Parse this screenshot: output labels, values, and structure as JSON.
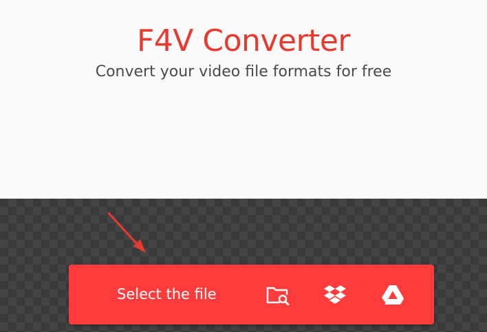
{
  "header": {
    "title": "F4V Converter",
    "subtitle": "Convert your video file formats for free"
  },
  "upload": {
    "select_label": "Select the file",
    "sources": [
      {
        "icon": "folder-search-icon"
      },
      {
        "icon": "dropbox-icon"
      },
      {
        "icon": "google-drive-icon"
      }
    ]
  },
  "colors": {
    "brand": "#e8392f",
    "button": "#ff3b3b",
    "dropzone": "#3a3a3a",
    "arrow": "#e8392f"
  }
}
